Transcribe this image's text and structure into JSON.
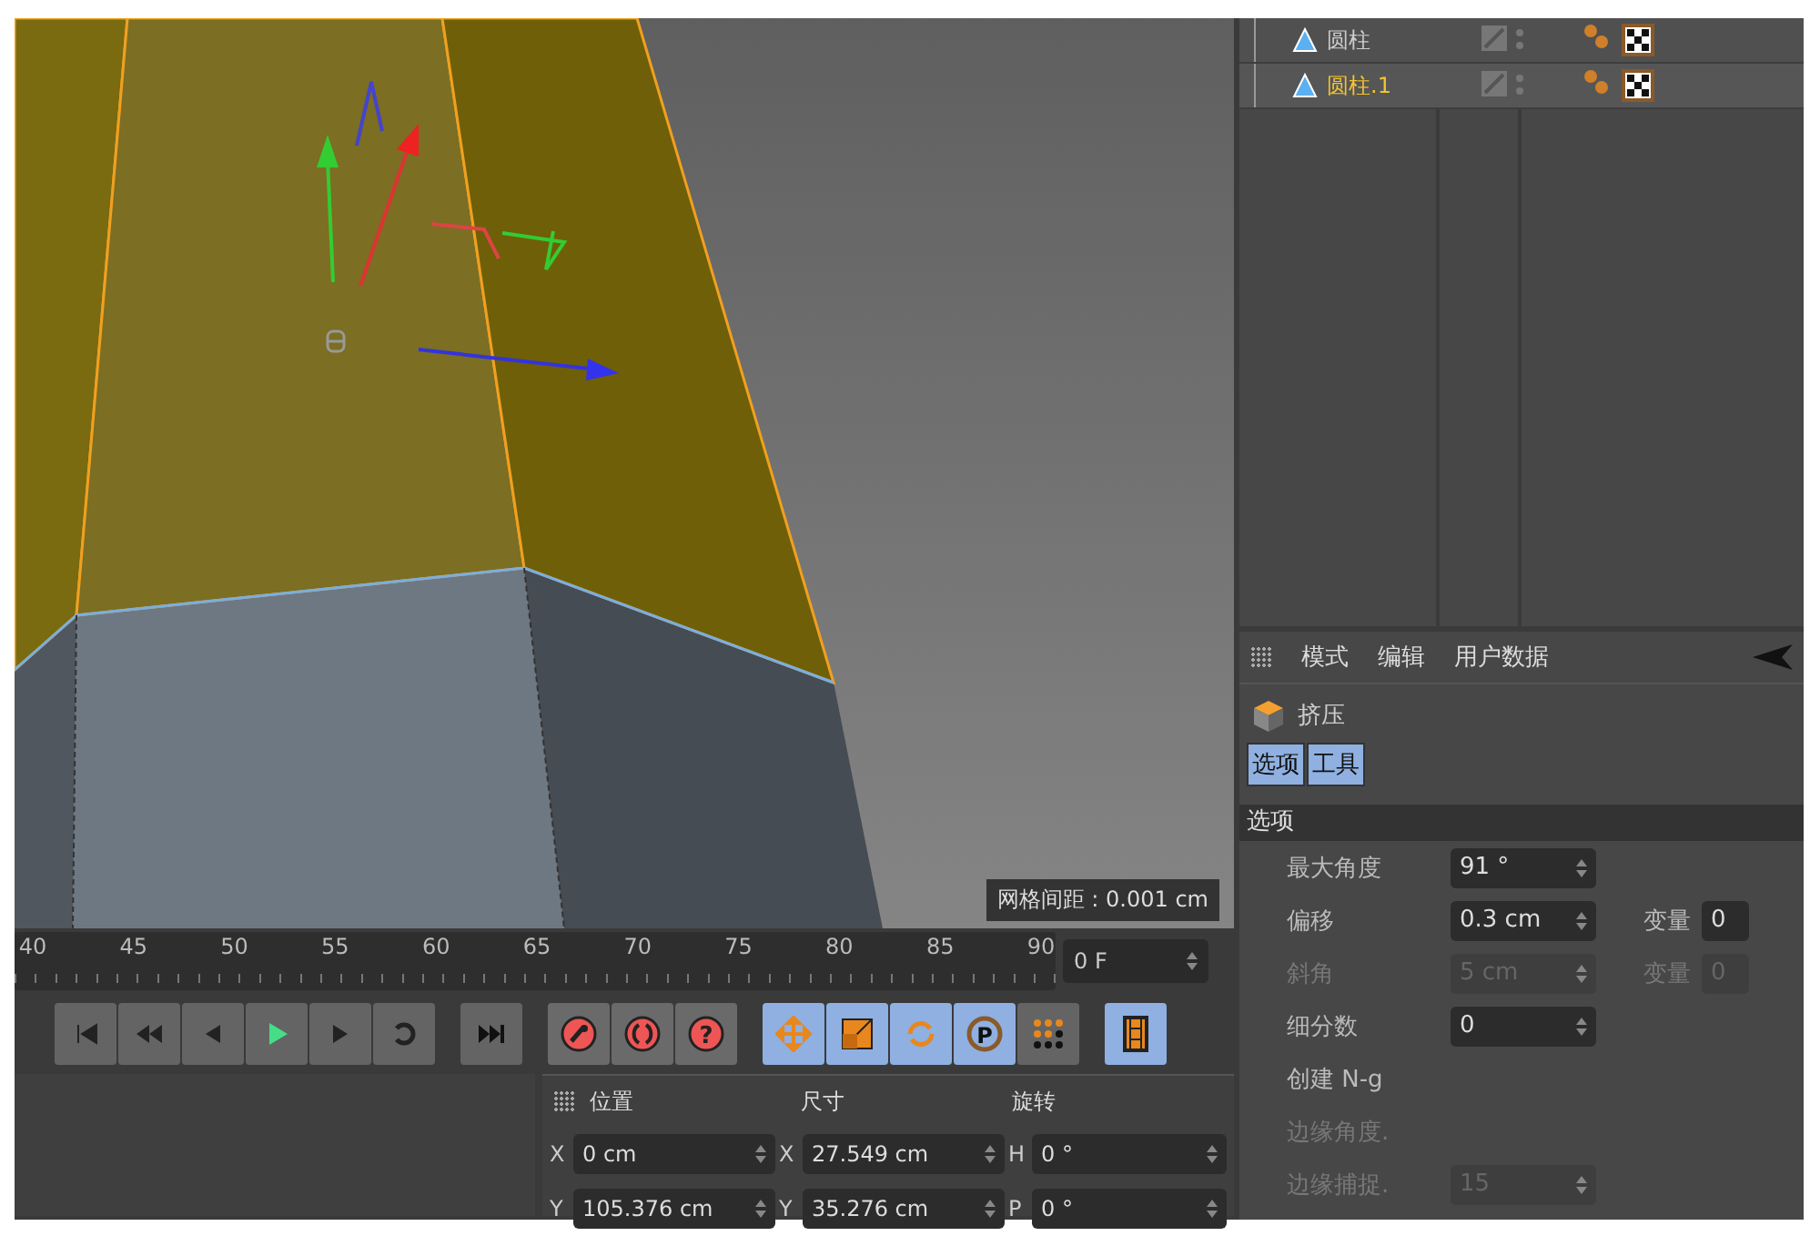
{
  "objects": [
    {
      "name": "圆柱",
      "selected": false
    },
    {
      "name": "圆柱.1",
      "selected": true
    }
  ],
  "viewport": {
    "grid_spacing": "网格间距 : 0.001 cm"
  },
  "timeline": {
    "ticks": [
      "40",
      "45",
      "50",
      "55",
      "60",
      "65",
      "70",
      "75",
      "80",
      "85",
      "90"
    ],
    "frame_field": "0 F"
  },
  "toolbar": {
    "transport": [
      {
        "kind": "first"
      },
      {
        "kind": "prev-key"
      },
      {
        "kind": "prev-frame"
      },
      {
        "kind": "play"
      },
      {
        "kind": "next-frame"
      },
      {
        "kind": "loop"
      }
    ],
    "end": [
      {
        "kind": "last"
      }
    ],
    "keys": [
      {
        "kind": "key-record"
      },
      {
        "kind": "auto-key"
      },
      {
        "kind": "key-help",
        "glyph": "?"
      }
    ],
    "tools": [
      {
        "kind": "move",
        "selected": true
      },
      {
        "kind": "scale",
        "selected": true
      },
      {
        "kind": "rotate",
        "selected": true
      },
      {
        "kind": "param",
        "selected": true,
        "glyph": "P"
      },
      {
        "kind": "dots",
        "selected": false
      }
    ],
    "film": {
      "selected": true
    }
  },
  "coordinates": {
    "headers": [
      "位置",
      "尺寸",
      "旋转"
    ],
    "rows": [
      {
        "cells": [
          {
            "axis": "X",
            "value": "0 cm"
          },
          {
            "axis": "X",
            "value": "27.549 cm"
          },
          {
            "axis": "H",
            "value": "0 °"
          }
        ]
      },
      {
        "cells": [
          {
            "axis": "Y",
            "value": "105.376 cm"
          },
          {
            "axis": "Y",
            "value": "35.276 cm"
          },
          {
            "axis": "P",
            "value": "0 °"
          }
        ]
      }
    ]
  },
  "attributes": {
    "menu": [
      "模式",
      "编辑",
      "用户数据"
    ],
    "title": "挤压",
    "tabs": [
      {
        "label": "选项",
        "selected": true
      },
      {
        "label": "工具",
        "selected": true
      }
    ],
    "section": "选项",
    "fields": [
      {
        "label": "最大角度",
        "value": "91 °",
        "disabled": false
      },
      {
        "label": "偏移",
        "value": "0.3 cm",
        "disabled": false,
        "side": {
          "label": "变量",
          "value": "0"
        }
      },
      {
        "label": "斜角",
        "value": "5 cm",
        "disabled": true,
        "side": {
          "label": "变量",
          "value": "0"
        }
      },
      {
        "label": "细分数",
        "value": "0",
        "disabled": false
      },
      {
        "label": "创建 N-g",
        "disabled": false
      },
      {
        "label": "边缘角度.",
        "disabled": true
      },
      {
        "label": "边缘捕捉.",
        "value": "15",
        "disabled": true
      }
    ]
  }
}
